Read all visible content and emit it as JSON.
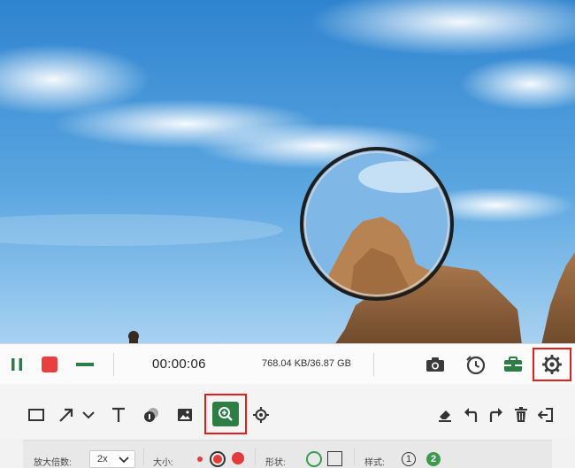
{
  "recording": {
    "timer": "00:00:06",
    "file_size": "768.04 KB/36.87 GB"
  },
  "options": {
    "zoom_label": "放大倍数:",
    "zoom_value": "2x",
    "size_label": "大小:",
    "shape_label": "形状:",
    "style_label": "样式:",
    "style_option_1": "1",
    "style_option_2": "2"
  },
  "colors": {
    "accent_green": "#2e7d45",
    "record_red": "#e8403f",
    "highlight_red": "#e11d1d",
    "shape_green": "#3c9a4e"
  },
  "icons": {
    "control_bar": [
      "pause-icon",
      "stop-icon",
      "minimize-icon",
      "camera-icon",
      "clock-icon",
      "toolbox-icon",
      "gear-icon"
    ],
    "tool_bar": [
      "rectangle-icon",
      "arrow-icon",
      "chevron-down-icon",
      "text-icon",
      "blur-icon",
      "image-icon",
      "magnifier-icon",
      "locate-icon",
      "eraser-icon",
      "undo-icon",
      "redo-icon",
      "trash-icon",
      "exit-icon"
    ]
  }
}
